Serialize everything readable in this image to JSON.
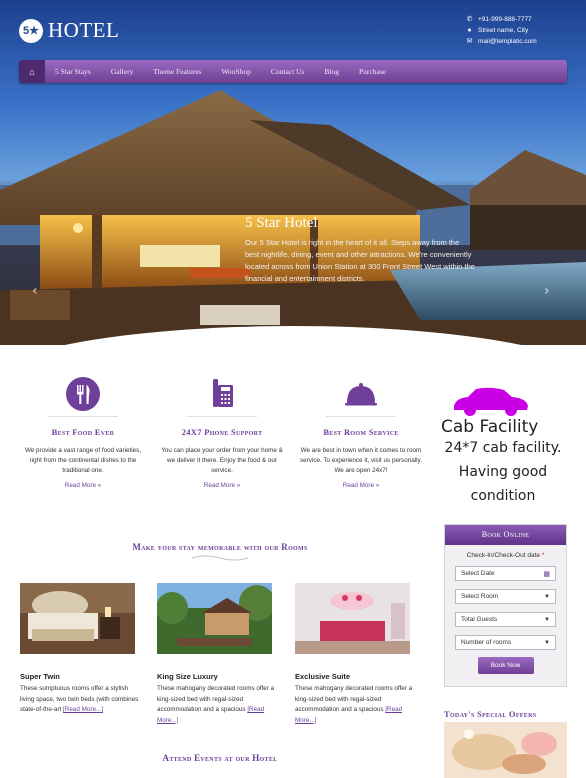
{
  "brand": {
    "badge": "5★",
    "name": "HOTEL"
  },
  "contact": {
    "phone": "+91-999-888-7777",
    "address": "Street name, City",
    "email": "mail@templatic.com"
  },
  "nav": {
    "home_icon": "home-icon",
    "items": [
      "5 Star Stays",
      "Gallery",
      "Theme Features",
      "WooShop",
      "Contact Us",
      "Blog",
      "Purchase"
    ]
  },
  "slider": {
    "title": "5 Star Hotel",
    "text": "Our 5 Star Hotel is right in the heart of it all. Steps away from the best nightlife, dining, event and other attractions. We're conveniently located across from Union Station at 300 Front Street West within the financial and entertainment districts.",
    "prev": "‹",
    "next": "›"
  },
  "features": [
    {
      "icon": "fork-knife-icon",
      "title": "Best Food Ever",
      "text": "We provide a vast range of food varieties, right from the continental dishes to the traditional one.",
      "more": "Read More »"
    },
    {
      "icon": "phone-icon",
      "title": "24X7 Phone Support",
      "text": "You can place your order from your home & we deliver it there. Enjoy the food & our service.",
      "more": "Read More »"
    },
    {
      "icon": "room-service-icon",
      "title": "Best Room Service",
      "text": "We are best in town when it comes to room service. To experience it, visit us personally. We are open 24x7!",
      "more": "Read More »"
    }
  ],
  "cab": {
    "title": "Cab Facility",
    "body": "24*7 cab facility. Having good condition"
  },
  "booking": {
    "header": "Book Online",
    "label": "Check-In/Check-Out date",
    "required": "*",
    "date_placeholder": "Select Date",
    "room_select": "Select Room",
    "guests_select": "Total Guests",
    "rooms_select": "Number of rooms",
    "button": "Book Now"
  },
  "offers": {
    "title": "Today's Special Offers"
  },
  "rooms_section": {
    "title": "Make your stay memorable with our Rooms",
    "rooms": [
      {
        "name": "Super Twin",
        "text": "These sumptuous rooms offer a stylish living space, two twin beds (with combines state-of-the-art",
        "link": "[Read More...]"
      },
      {
        "name": "King Size Luxury",
        "text": "These mahogany decorated rooms offer a king-sized bed with regal-sized accommodation and a spacious",
        "link": "[Read More...]"
      },
      {
        "name": "Exclusive Suite",
        "text": "These mahogany decorated rooms offer a king-sized bed with regal-sized accommodation and a spacious",
        "link": "[Read More...]"
      }
    ]
  },
  "events": {
    "title": "Attend Events at our Hotel"
  },
  "colors": {
    "accent": "#6f3f9a",
    "nav_top": "#9a6bc0",
    "nav_bottom": "#6e3f94",
    "required": "#c8102e",
    "cab_car": "#c900e6"
  }
}
